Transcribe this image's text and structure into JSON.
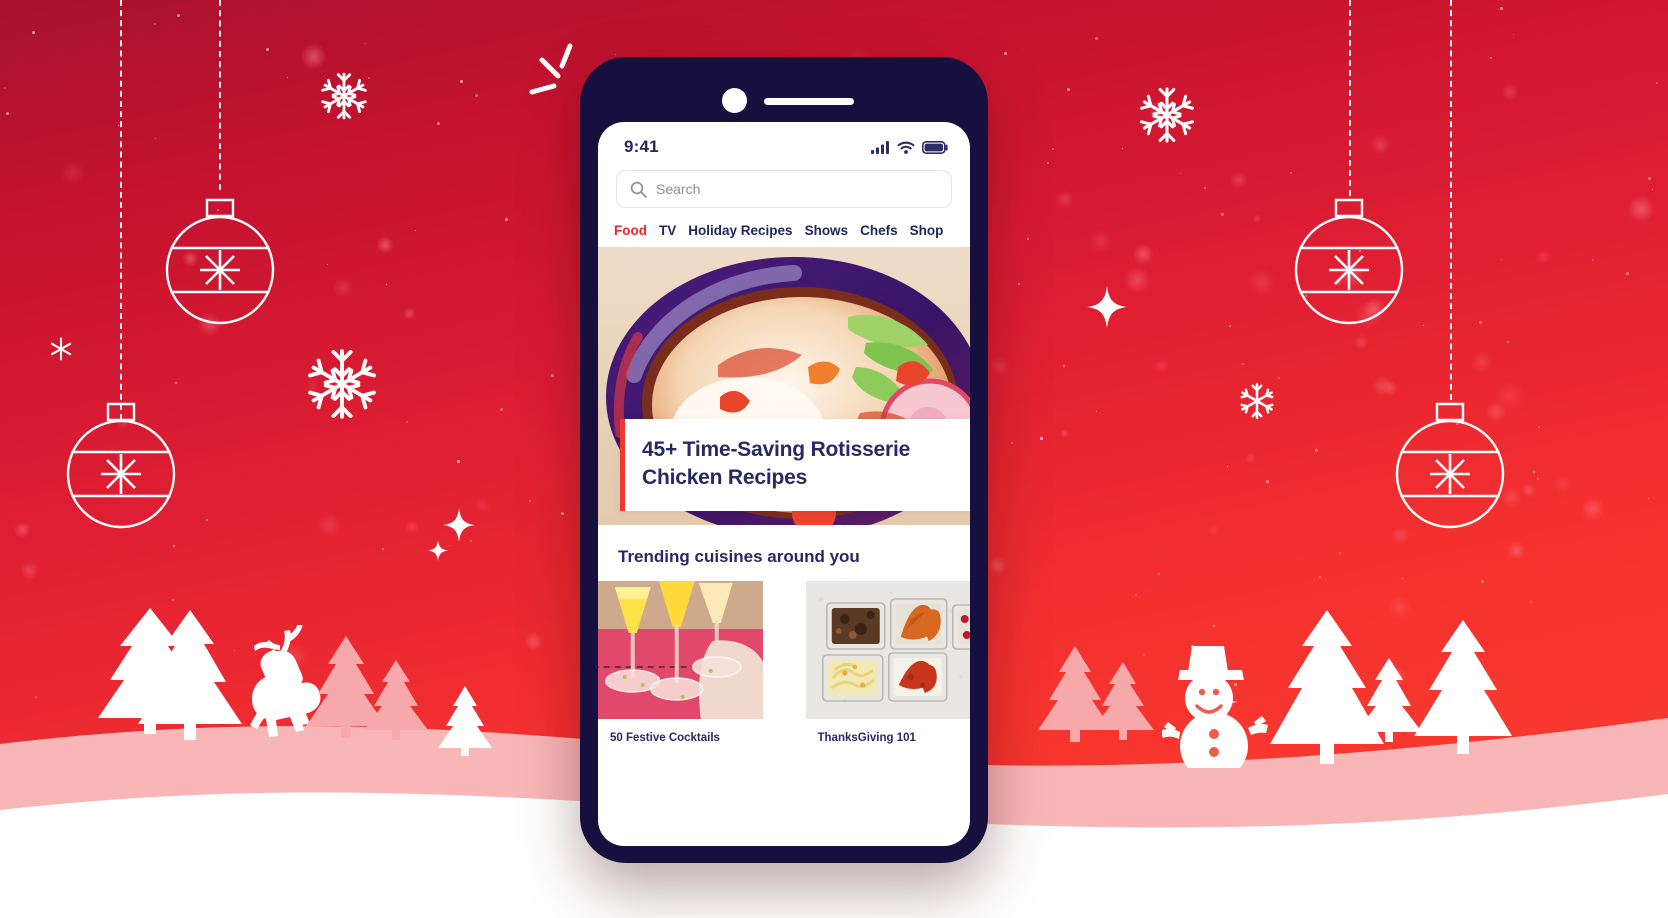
{
  "scene": {
    "background_top_color": "#a8122c",
    "background_bottom_color": "#fb4730",
    "snow_color": "#ffffff",
    "snow_shadow_color": "#f9b3b4",
    "decor_line_color": "#ffffff"
  },
  "phone": {
    "body_color": "#170f3e",
    "camera_icon": "camera-dot",
    "speaker_icon": "speaker-bar"
  },
  "status_bar": {
    "time": "9:41",
    "icons": [
      "cellular-signal-icon",
      "wifi-icon",
      "battery-icon"
    ]
  },
  "search": {
    "icon": "search-icon",
    "placeholder": "Search",
    "value": ""
  },
  "nav": {
    "active_color": "#f5232a",
    "inactive_color": "#23265c",
    "tabs": [
      {
        "label": "Food",
        "active": true
      },
      {
        "label": "TV",
        "active": false
      },
      {
        "label": "Holiday Recipes",
        "active": false
      },
      {
        "label": "Shows",
        "active": false
      },
      {
        "label": "Chefs",
        "active": false
      },
      {
        "label": "Shop",
        "active": false
      }
    ]
  },
  "hero": {
    "image_alt": "bowl-of-soup-photo",
    "headline": "45+ Time-Saving Rotisserie Chicken Recipes",
    "accent_color": "#f23630"
  },
  "trending": {
    "title": "Trending cuisines around you",
    "cards": [
      {
        "label": "50 Festive Cocktails",
        "image_alt": "mimosa-cocktails-photo"
      },
      {
        "label": "ThanksGiving 101",
        "image_alt": "meal-prep-containers-photo"
      }
    ]
  }
}
